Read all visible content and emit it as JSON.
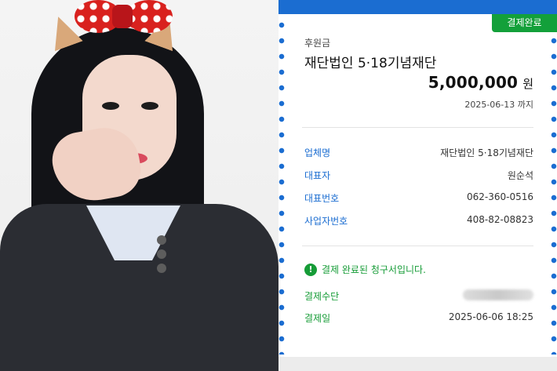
{
  "receipt": {
    "status_badge": "결제완료",
    "sub_label": "후원금",
    "title": "재단법인 5·18기념재단",
    "amount": "5,000,000",
    "currency": "원",
    "due_date": "2025-06-13 까지",
    "details": [
      {
        "key": "업체명",
        "value": "재단법인 5·18기념재단"
      },
      {
        "key": "대표자",
        "value": "원순석"
      },
      {
        "key": "대표번호",
        "value": "062-360-0516"
      },
      {
        "key": "사업자번호",
        "value": "408-82-08823"
      }
    ],
    "notice": "결제 완료된 청구서입니다.",
    "notice_icon": "exclamation-icon",
    "payment": [
      {
        "key": "결제수단",
        "value": ""
      },
      {
        "key": "결제일",
        "value": "2025-06-06 18:25"
      }
    ]
  },
  "colors": {
    "accent_blue": "#1b6dd1",
    "accent_green": "#169c37"
  }
}
